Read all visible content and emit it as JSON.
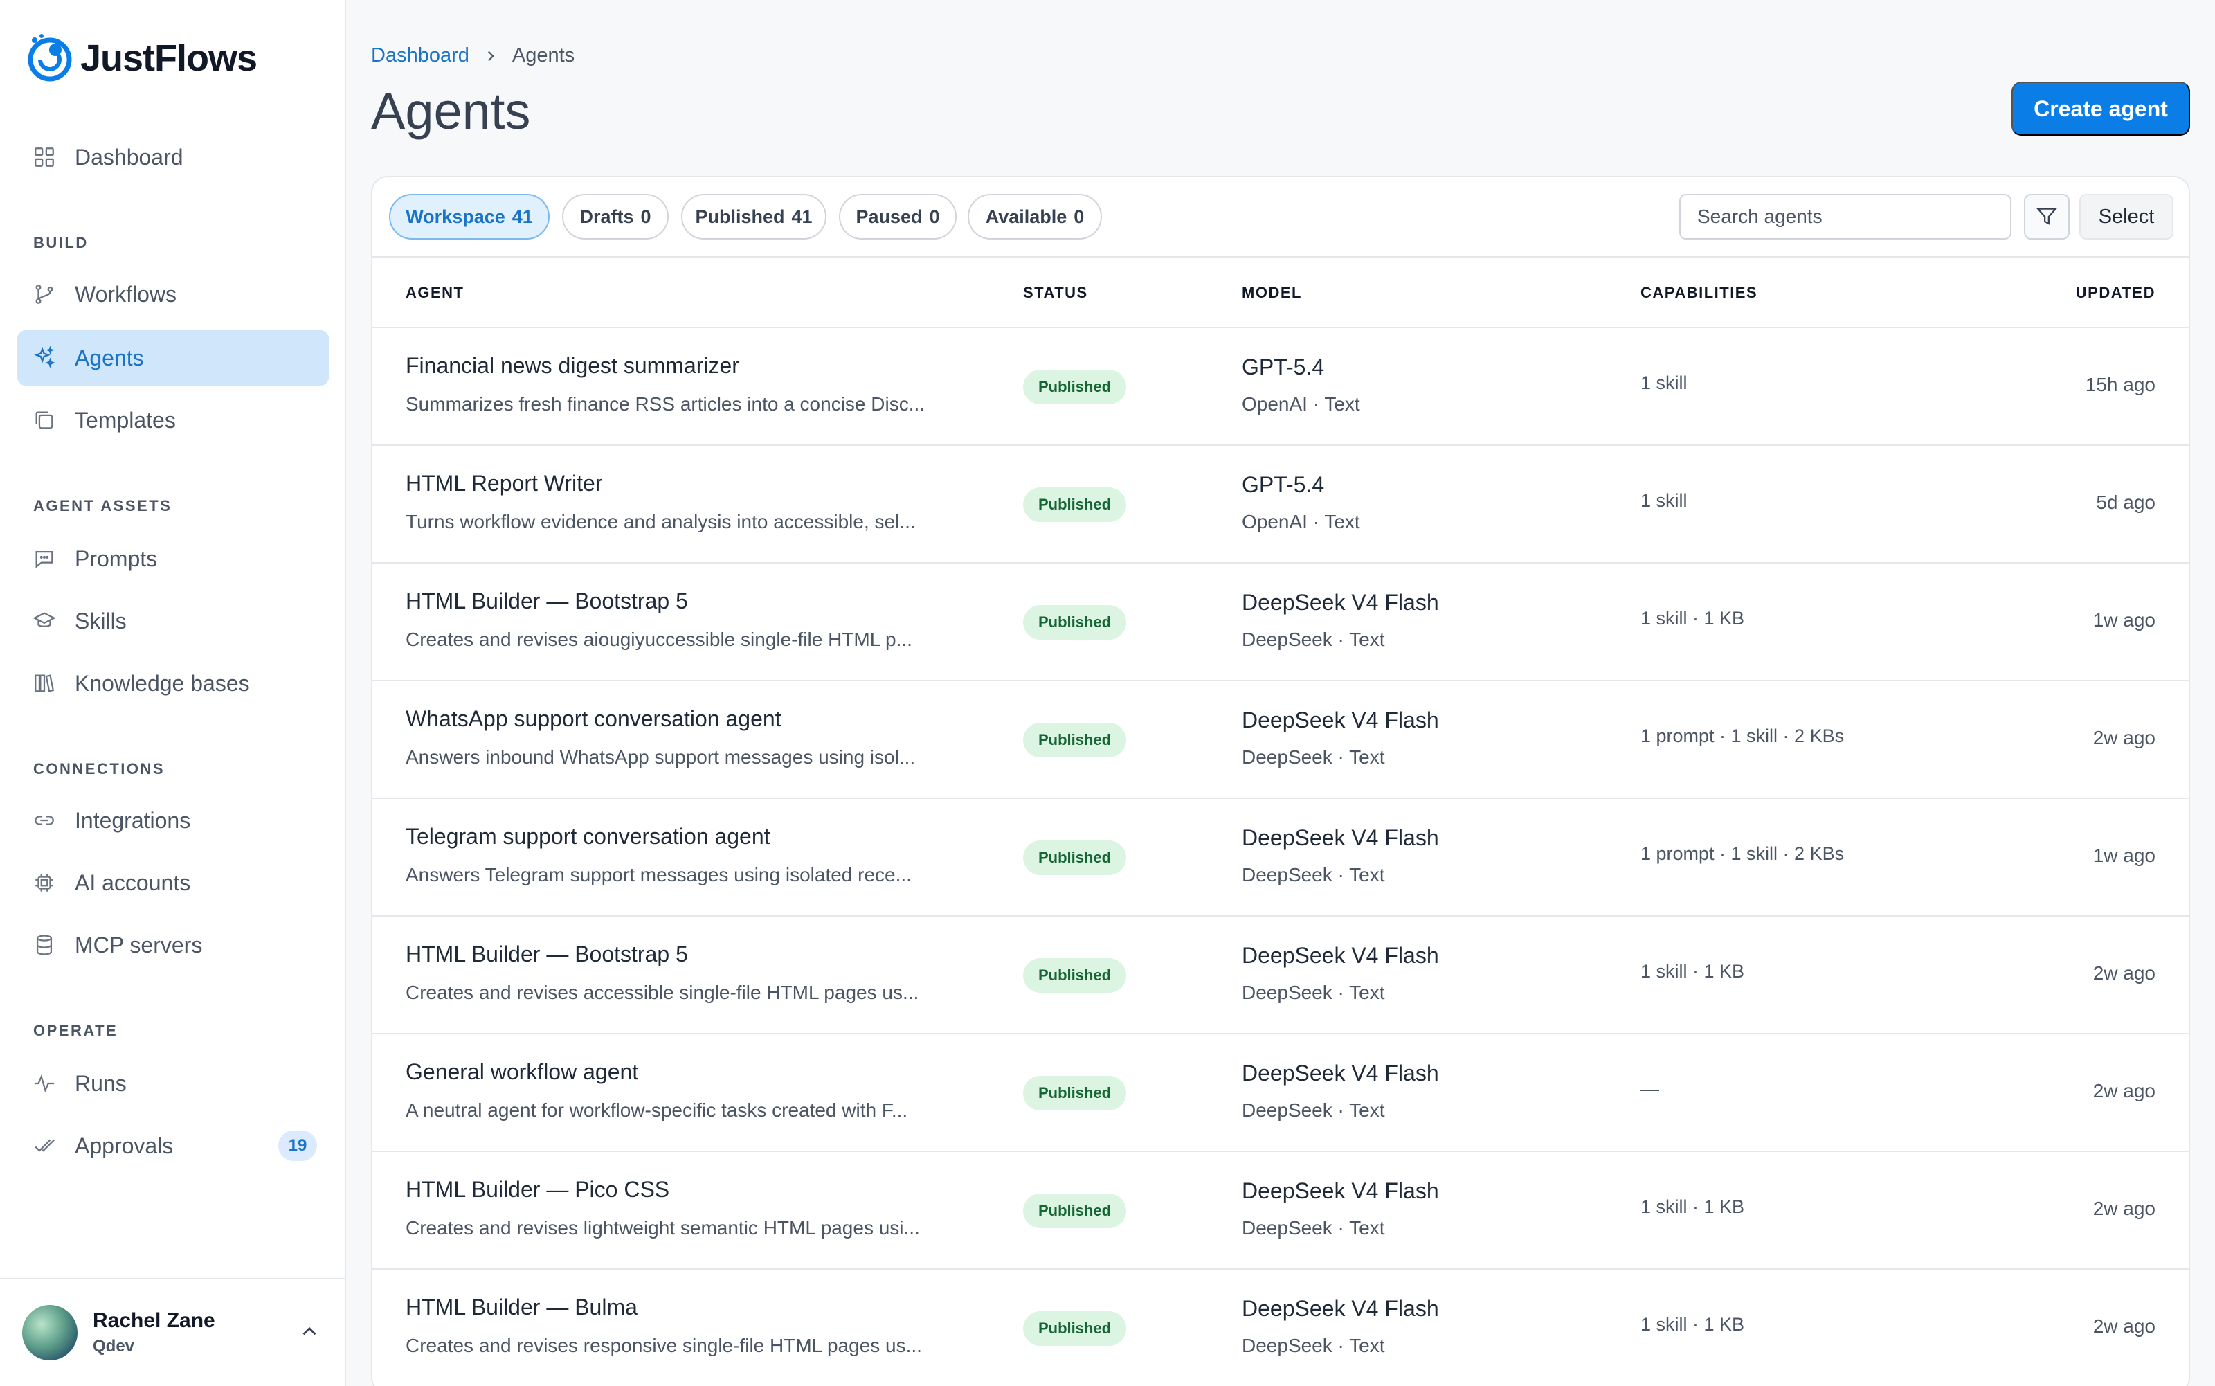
{
  "brand": {
    "name": "JustFlows",
    "accent": "#0b7de6"
  },
  "sidebar": {
    "dashboard": "Dashboard",
    "sections": {
      "build": "BUILD",
      "agent_assets": "AGENT ASSETS",
      "connections": "CONNECTIONS",
      "operate": "OPERATE"
    },
    "items": {
      "workflows": "Workflows",
      "agents": "Agents",
      "templates": "Templates",
      "prompts": "Prompts",
      "skills": "Skills",
      "knowledge_bases": "Knowledge bases",
      "integrations": "Integrations",
      "ai_accounts": "AI accounts",
      "mcp_servers": "MCP servers",
      "runs": "Runs",
      "approvals": "Approvals",
      "approvals_badge": "19"
    },
    "user": {
      "name": "Rachel Zane",
      "org": "Qdev"
    }
  },
  "header": {
    "breadcrumb_root": "Dashboard",
    "breadcrumb_current": "Agents",
    "title": "Agents",
    "create_label": "Create agent"
  },
  "filters": {
    "workspace": {
      "label": "Workspace",
      "count": "41"
    },
    "drafts": {
      "label": "Drafts",
      "count": "0"
    },
    "published": {
      "label": "Published",
      "count": "41"
    },
    "paused": {
      "label": "Paused",
      "count": "0"
    },
    "available": {
      "label": "Available",
      "count": "0"
    },
    "search_placeholder": "Search agents",
    "select_label": "Select"
  },
  "table": {
    "columns": {
      "agent": "AGENT",
      "status": "STATUS",
      "model": "MODEL",
      "capabilities": "CAPABILITIES",
      "updated": "UPDATED"
    },
    "rows": [
      {
        "name": "Financial news digest summarizer",
        "desc": "Summarizes fresh finance RSS articles into a concise Disc...",
        "status": "Published",
        "model": "GPT-5.4",
        "provider": "OpenAI · Text",
        "caps": "1 skill",
        "updated": "15h ago"
      },
      {
        "name": "HTML Report Writer",
        "desc": "Turns workflow evidence and analysis into accessible, sel...",
        "status": "Published",
        "model": "GPT-5.4",
        "provider": "OpenAI · Text",
        "caps": "1 skill",
        "updated": "5d ago"
      },
      {
        "name": "HTML Builder — Bootstrap 5",
        "desc": "Creates and revises aiougiyuccessible single-file HTML p...",
        "status": "Published",
        "model": "DeepSeek V4 Flash",
        "provider": "DeepSeek · Text",
        "caps": "1 skill · 1 KB",
        "updated": "1w ago"
      },
      {
        "name": "WhatsApp support conversation agent",
        "desc": "Answers inbound WhatsApp support messages using isol...",
        "status": "Published",
        "model": "DeepSeek V4 Flash",
        "provider": "DeepSeek · Text",
        "caps": "1 prompt · 1 skill · 2 KBs",
        "updated": "2w ago"
      },
      {
        "name": "Telegram support conversation agent",
        "desc": "Answers Telegram support messages using isolated rece...",
        "status": "Published",
        "model": "DeepSeek V4 Flash",
        "provider": "DeepSeek · Text",
        "caps": "1 prompt · 1 skill · 2 KBs",
        "updated": "1w ago"
      },
      {
        "name": "HTML Builder — Bootstrap 5",
        "desc": "Creates and revises accessible single-file HTML pages us...",
        "status": "Published",
        "model": "DeepSeek V4 Flash",
        "provider": "DeepSeek · Text",
        "caps": "1 skill · 1 KB",
        "updated": "2w ago"
      },
      {
        "name": "General workflow agent",
        "desc": "A neutral agent for workflow-specific tasks created with F...",
        "status": "Published",
        "model": "DeepSeek V4 Flash",
        "provider": "DeepSeek · Text",
        "caps": "—",
        "updated": "2w ago"
      },
      {
        "name": "HTML Builder — Pico CSS",
        "desc": "Creates and revises lightweight semantic HTML pages usi...",
        "status": "Published",
        "model": "DeepSeek V4 Flash",
        "provider": "DeepSeek · Text",
        "caps": "1 skill · 1 KB",
        "updated": "2w ago"
      },
      {
        "name": "HTML Builder — Bulma",
        "desc": "Creates and revises responsive single-file HTML pages us...",
        "status": "Published",
        "model": "DeepSeek V4 Flash",
        "provider": "DeepSeek · Text",
        "caps": "1 skill · 1 KB",
        "updated": "2w ago"
      }
    ]
  }
}
